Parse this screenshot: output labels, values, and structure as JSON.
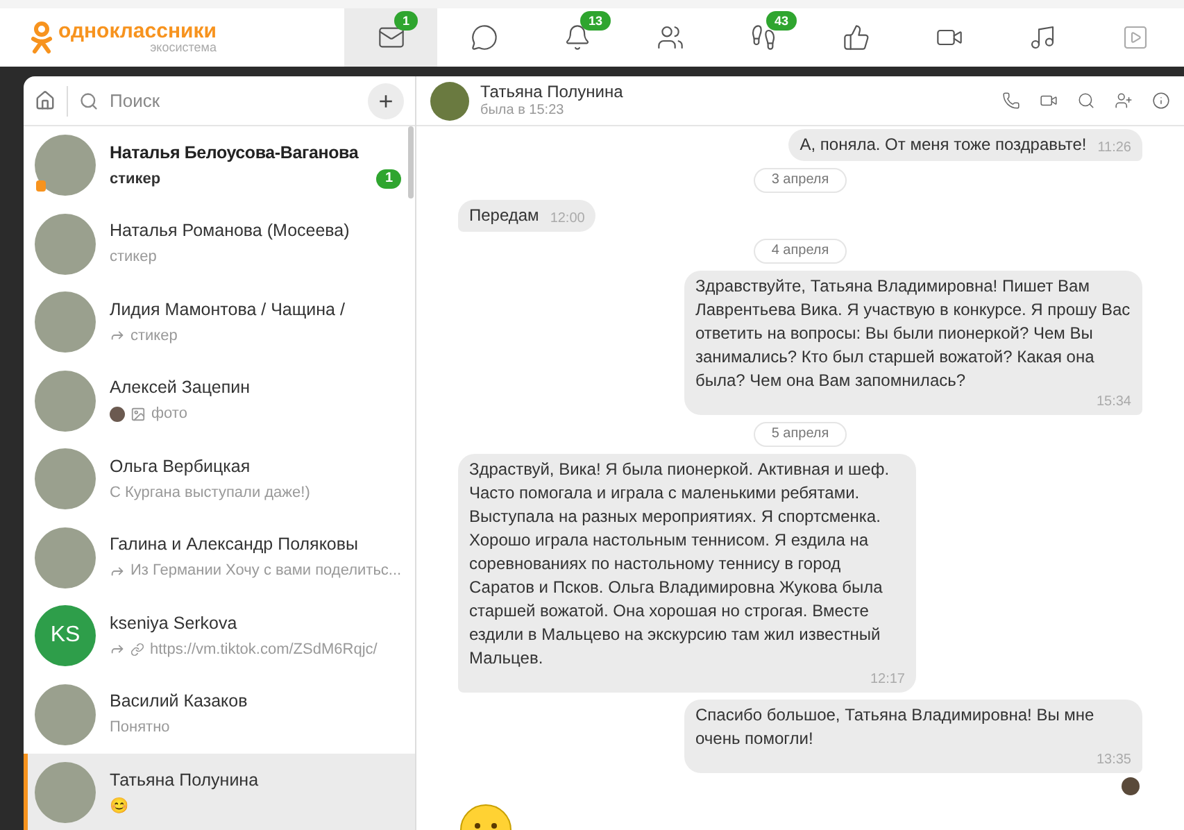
{
  "logo": {
    "name": "одноклассники",
    "sub": "экосистема"
  },
  "nav": [
    {
      "kind": "mail",
      "selected": true,
      "badge": "1"
    },
    {
      "kind": "chat",
      "selected": false
    },
    {
      "kind": "bell",
      "selected": false,
      "badge": "13"
    },
    {
      "kind": "friends",
      "selected": false
    },
    {
      "kind": "guests",
      "selected": false,
      "badge": "43"
    },
    {
      "kind": "like",
      "selected": false
    },
    {
      "kind": "video",
      "selected": false
    },
    {
      "kind": "music",
      "selected": false
    },
    {
      "kind": "play",
      "selected": false
    }
  ],
  "search": {
    "placeholder": "Поиск",
    "add": "+"
  },
  "chats": [
    {
      "kind": "plain",
      "name": "Наталья Белоусова-Ваганова",
      "preview": "стикер",
      "unread": true,
      "ok_mark": true,
      "badge": "1",
      "selected": false
    },
    {
      "kind": "plain",
      "name": "Наталья Романова (Мосеева)",
      "preview": "стикер",
      "unread": false,
      "ok_mark": false,
      "selected": false
    },
    {
      "kind": "forward",
      "name": "Лидия Мамонтова / Чащина /",
      "preview": "стикер",
      "unread": false,
      "ok_mark": false,
      "selected": false
    },
    {
      "kind": "photo",
      "name": "Алексей Зацепин",
      "preview": "фото",
      "unread": false,
      "ok_mark": false,
      "selected": false
    },
    {
      "kind": "plain",
      "name": "Ольга Вербицкая",
      "preview": "С Кургана выступали даже!)",
      "unread": false,
      "ok_mark": false,
      "selected": false
    },
    {
      "kind": "forward",
      "name": "Галина и Александр Поляковы",
      "preview": "Из Германии Хочу с вами поделитьс...",
      "unread": false,
      "ok_mark": false,
      "selected": false
    },
    {
      "kind": "link",
      "name": "kseniya Serkova",
      "initials": "KS",
      "preview": "https://vm.tiktok.com/ZSdM6Rqjc/",
      "unread": false,
      "ok_mark": false,
      "selected": false
    },
    {
      "kind": "plain",
      "name": "Василий Казаков",
      "preview": "Понятно",
      "unread": false,
      "ok_mark": false,
      "selected": false
    },
    {
      "kind": "plain",
      "name": "Татьяна Полунина",
      "preview": "😊",
      "unread": false,
      "ok_mark": false,
      "selected": true
    }
  ],
  "header": {
    "name": "Татьяна Полунина",
    "status": "была в 15:23"
  },
  "messages": [
    {
      "kind": "message",
      "outgoing": true,
      "text": "А, поняла. От меня тоже поздравьте!",
      "time": "11:26"
    },
    {
      "kind": "date",
      "text": "3 апреля"
    },
    {
      "kind": "message",
      "outgoing": false,
      "text": "Передам",
      "time": "12:00"
    },
    {
      "kind": "date",
      "text": "4 апреля"
    },
    {
      "kind": "message",
      "outgoing": true,
      "text": "Здравствуйте, Татьяна Владимировна! Пишет Вам Лаврентьева Вика. Я участвую в конкурсе. Я прошу Вас ответить на вопросы: Вы были пионеркой? Чем Вы занимались? Кто был старшей вожатой? Какая она была? Чем она Вам запомнилась?",
      "time": "15:34"
    },
    {
      "kind": "date",
      "text": "5 апреля"
    },
    {
      "kind": "message",
      "outgoing": false,
      "text": "Здраствуй, Вика! Я была пионеркой. Активная и шеф. Часто помогала и играла с маленькими ребятами. Выступала на разных мероприятиях. Я спортсменка. Хорошо играла настольным теннисом. Я ездила на соревнованиях по настольному теннису в город Саратов и Псков. Ольга Владимировна Жукова была старшей вожатой. Она хорошая но строгая. Вместе ездили в Мальцево на экскурсию там жил известный Мальцев.",
      "time": "12:17"
    },
    {
      "kind": "message",
      "outgoing": true,
      "text": "Спасибо большое, Татьяна Владимировна! Вы мне очень помогли!",
      "time": "13:35",
      "read": true
    },
    {
      "kind": "sticker"
    }
  ]
}
